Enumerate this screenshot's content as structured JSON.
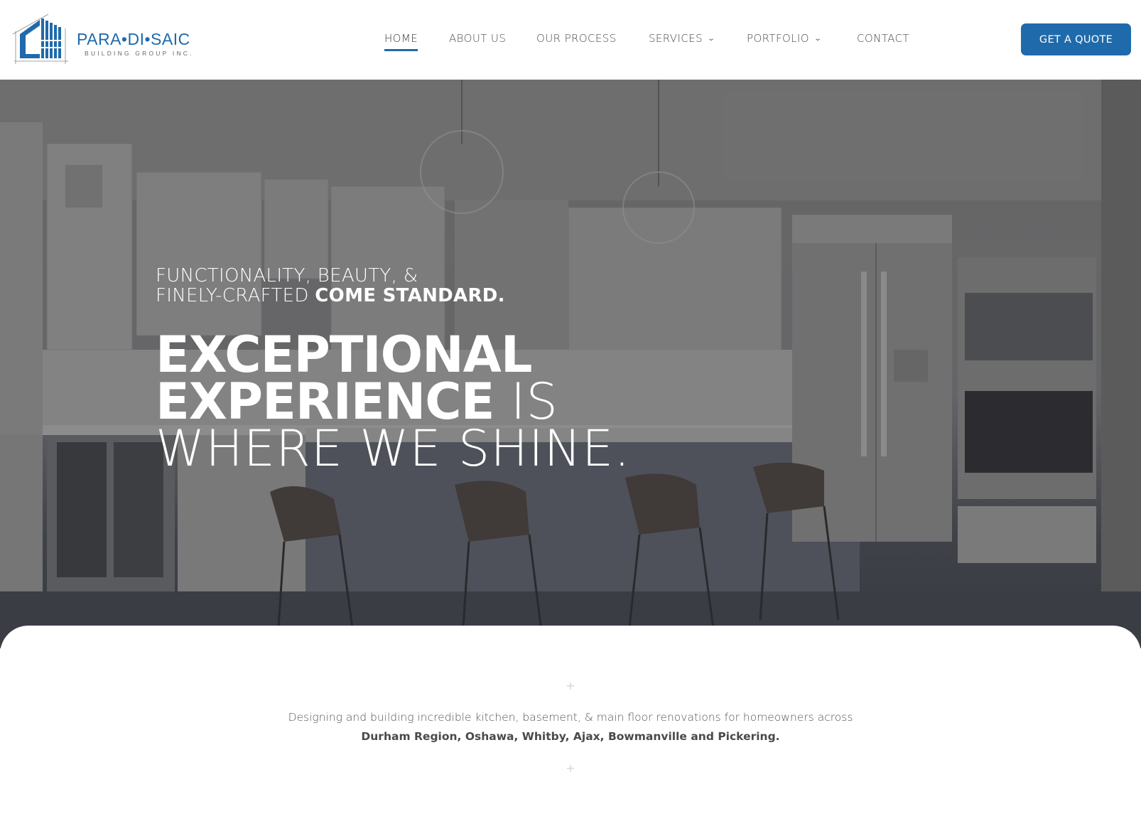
{
  "brand": {
    "name": "PARA•DI•SAIC",
    "subtitle": "BUILDING GROUP INC.",
    "color": "#1f6aab"
  },
  "nav": {
    "items": [
      {
        "label": "HOME",
        "active": true,
        "has_dropdown": false
      },
      {
        "label": "ABOUT US",
        "active": false,
        "has_dropdown": false
      },
      {
        "label": "OUR PROCESS",
        "active": false,
        "has_dropdown": false
      },
      {
        "label": "SERVICES",
        "active": false,
        "has_dropdown": true
      },
      {
        "label": "PORTFOLIO",
        "active": false,
        "has_dropdown": true
      },
      {
        "label": "CONTACT",
        "active": false,
        "has_dropdown": false
      }
    ],
    "dropdown_icon": "chevron-down-icon",
    "cta_label": "GET A QUOTE",
    "cta_color": "#1f6aab"
  },
  "hero": {
    "tagline_line1": "FUNCTIONALITY, BEAUTY, &",
    "tagline_line2_light": "FINELY-CRAFTED",
    "tagline_line2_bold": "COME STANDARD.",
    "headline_line1_bold": "EXCEPTIONAL",
    "headline_line2_bold": "EXPERIENCE",
    "headline_line2_light": "IS",
    "headline_line3_light": "WHERE WE SHINE.",
    "background": "kitchen-photo"
  },
  "intro": {
    "divider_icon": "plus-icon",
    "text_light": "Designing and building incredible kitchen, basement, & main floor renovations for homeowners across",
    "text_bold": "Durham Region, Oshawa, Whitby, Ajax, Bowmanville and Pickering."
  }
}
